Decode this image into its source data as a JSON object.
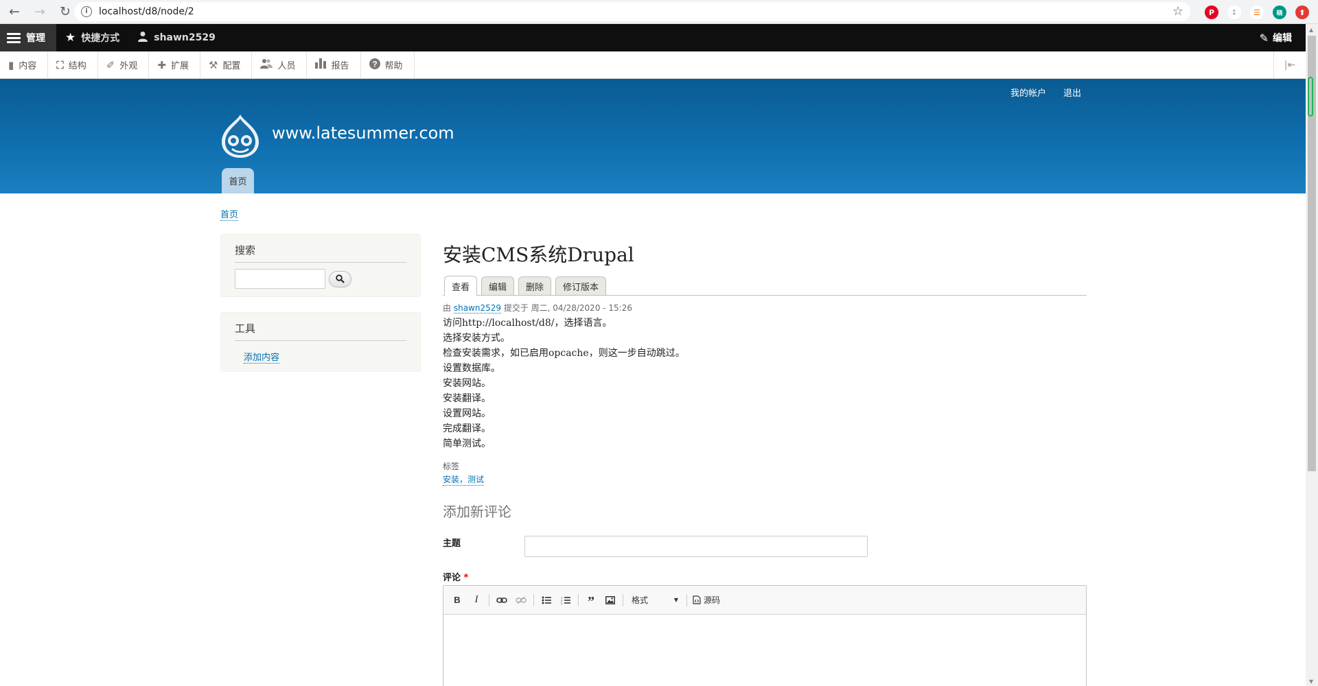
{
  "browser": {
    "url": "localhost/d8/node/2",
    "extensions": [
      {
        "name": "pinterest-ext",
        "label": "P",
        "color": "#e60023"
      },
      {
        "name": "grey-ext-1",
        "label": "⁑",
        "color": "#9aa0a6"
      },
      {
        "name": "orange-ext",
        "label": "☰",
        "color": "#e8710a"
      },
      {
        "name": "profile-ext",
        "label": "晓",
        "color": "#009688"
      },
      {
        "name": "red-ext",
        "label": "⬆",
        "color": "#e53935"
      }
    ]
  },
  "toolbar": {
    "manage": "管理",
    "shortcuts": "快捷方式",
    "user": "shawn2529",
    "edit": "编辑"
  },
  "tray": {
    "items": [
      {
        "label": "内容",
        "icon": "document-icon"
      },
      {
        "label": "结构",
        "icon": "structure-icon"
      },
      {
        "label": "外观",
        "icon": "paintbrush-icon"
      },
      {
        "label": "扩展",
        "icon": "puzzle-icon"
      },
      {
        "label": "配置",
        "icon": "wrench-icon"
      },
      {
        "label": "人员",
        "icon": "people-icon"
      },
      {
        "label": "报告",
        "icon": "chart-icon"
      },
      {
        "label": "帮助",
        "icon": "help-icon"
      }
    ]
  },
  "header": {
    "account": "我的帐户",
    "logout": "退出",
    "site_name": "www.latesummer.com",
    "home_tab": "首页"
  },
  "breadcrumb": "首页",
  "sidebar": {
    "search_title": "搜索",
    "tools_title": "工具",
    "tools_link": "添加内容"
  },
  "node": {
    "title": "安装CMS系统Drupal",
    "tabs": [
      "查看",
      "编辑",
      "删除",
      "修订版本"
    ],
    "submitted_prefix": "由",
    "author": "shawn2529",
    "submitted_suffix": "提交于 周二, 04/28/2020 - 15:26",
    "lines": [
      "访问http://localhost/d8/，选择语言。",
      "选择安装方式。",
      "检查安装需求，如已启用opcache，则这一步自动跳过。",
      "设置数据库。",
      "安装网站。",
      "安装翻译。",
      "设置网站。",
      "完成翻译。",
      "简单测试。"
    ],
    "tags_label": "标签",
    "tags": "安装，测试"
  },
  "comment": {
    "heading": "添加新评论",
    "subject_label": "主题",
    "comment_label": "评论",
    "required_mark": "*",
    "format_label": "格式",
    "source_label": "源码"
  }
}
